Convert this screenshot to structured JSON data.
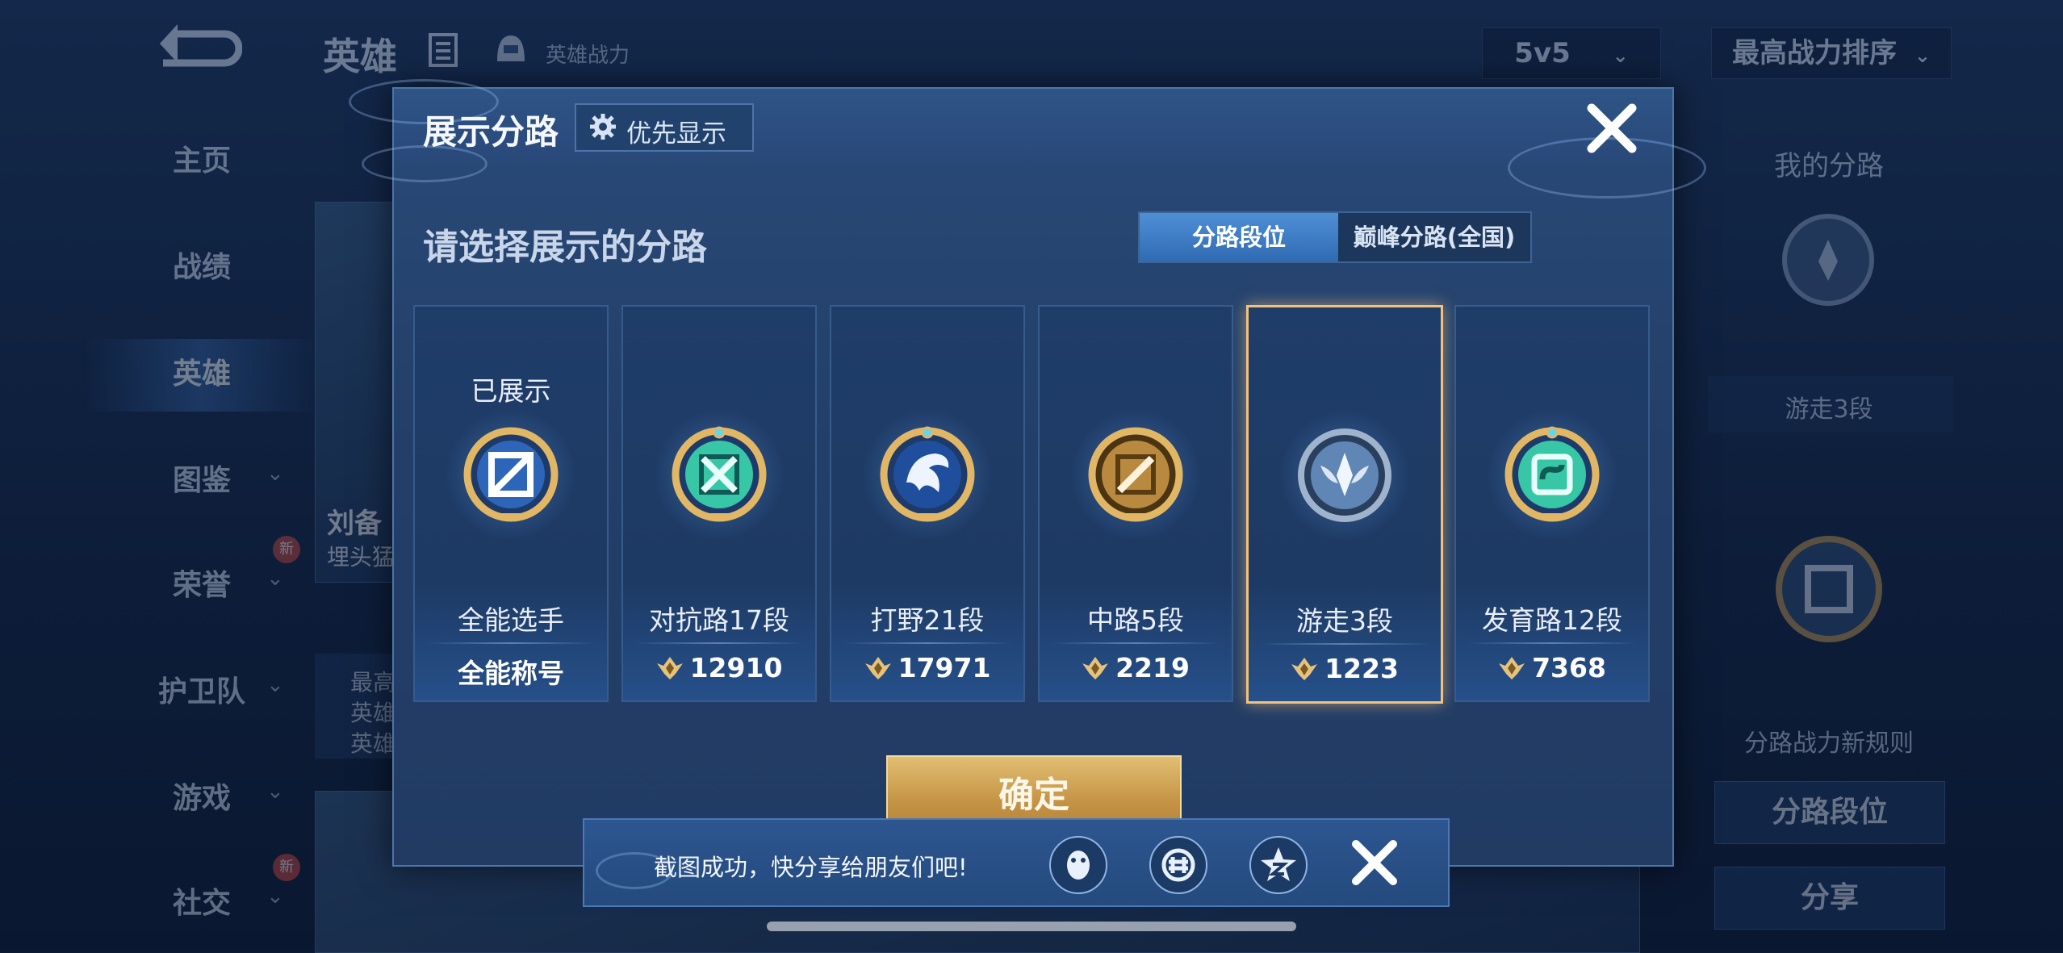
{
  "background": {
    "header_title": "英雄",
    "header_sub": "英雄战力",
    "mode_dropdown": "5v5",
    "sort_dropdown": "最高战力排序",
    "nav": [
      {
        "label": "主页",
        "chevron": false,
        "new": false
      },
      {
        "label": "战绩",
        "chevron": false,
        "new": false
      },
      {
        "label": "英雄",
        "chevron": false,
        "new": false
      },
      {
        "label": "图鉴",
        "chevron": true,
        "new": false
      },
      {
        "label": "荣誉",
        "chevron": true,
        "new": true
      },
      {
        "label": "护卫队",
        "chevron": true,
        "new": false
      },
      {
        "label": "游戏",
        "chevron": true,
        "new": false
      },
      {
        "label": "社交",
        "chevron": true,
        "new": true
      }
    ],
    "new_badge": "新",
    "hero_card_name": "刘备",
    "hero_card_sub": "埋头猛",
    "hero_card_lines": [
      "最高",
      "英雄",
      "英雄"
    ],
    "right_panel": {
      "title": "我的分路",
      "lane": "游走3段",
      "rules": "分路战力新规则",
      "button_lane": "分路段位",
      "button_share": "分享"
    }
  },
  "modal": {
    "title": "展示分路",
    "priority_button": "优先显示",
    "prompt": "请选择展示的分路",
    "tabs": [
      "分路段位",
      "巅峰分路(全国)"
    ],
    "active_tab": 0,
    "cards": [
      {
        "top_label": "已展示",
        "name": "全能选手",
        "value": "全能称号",
        "show_power_icon": false,
        "emblem": "allround",
        "selected": false
      },
      {
        "top_label": "",
        "name": "对抗路17段",
        "value": "12910",
        "show_power_icon": true,
        "emblem": "clash",
        "selected": false
      },
      {
        "top_label": "",
        "name": "打野21段",
        "value": "17971",
        "show_power_icon": true,
        "emblem": "jungle",
        "selected": false
      },
      {
        "top_label": "",
        "name": "中路5段",
        "value": "2219",
        "show_power_icon": true,
        "emblem": "mid",
        "selected": false
      },
      {
        "top_label": "",
        "name": "游走3段",
        "value": "1223",
        "show_power_icon": true,
        "emblem": "roam",
        "selected": true
      },
      {
        "top_label": "",
        "name": "发育路12段",
        "value": "7368",
        "show_power_icon": true,
        "emblem": "farm",
        "selected": false
      }
    ],
    "confirm": "确定"
  },
  "toast": {
    "text": "截图成功，快分享给朋友们吧!",
    "icons": [
      "qq-icon",
      "wechat-moments-icon",
      "qzone-icon"
    ]
  },
  "colors": {
    "gold": "#e6c27b",
    "teal": "#3fd1b0",
    "accent_blue": "#3f7cc4",
    "selected_border": "#f3c27a"
  }
}
